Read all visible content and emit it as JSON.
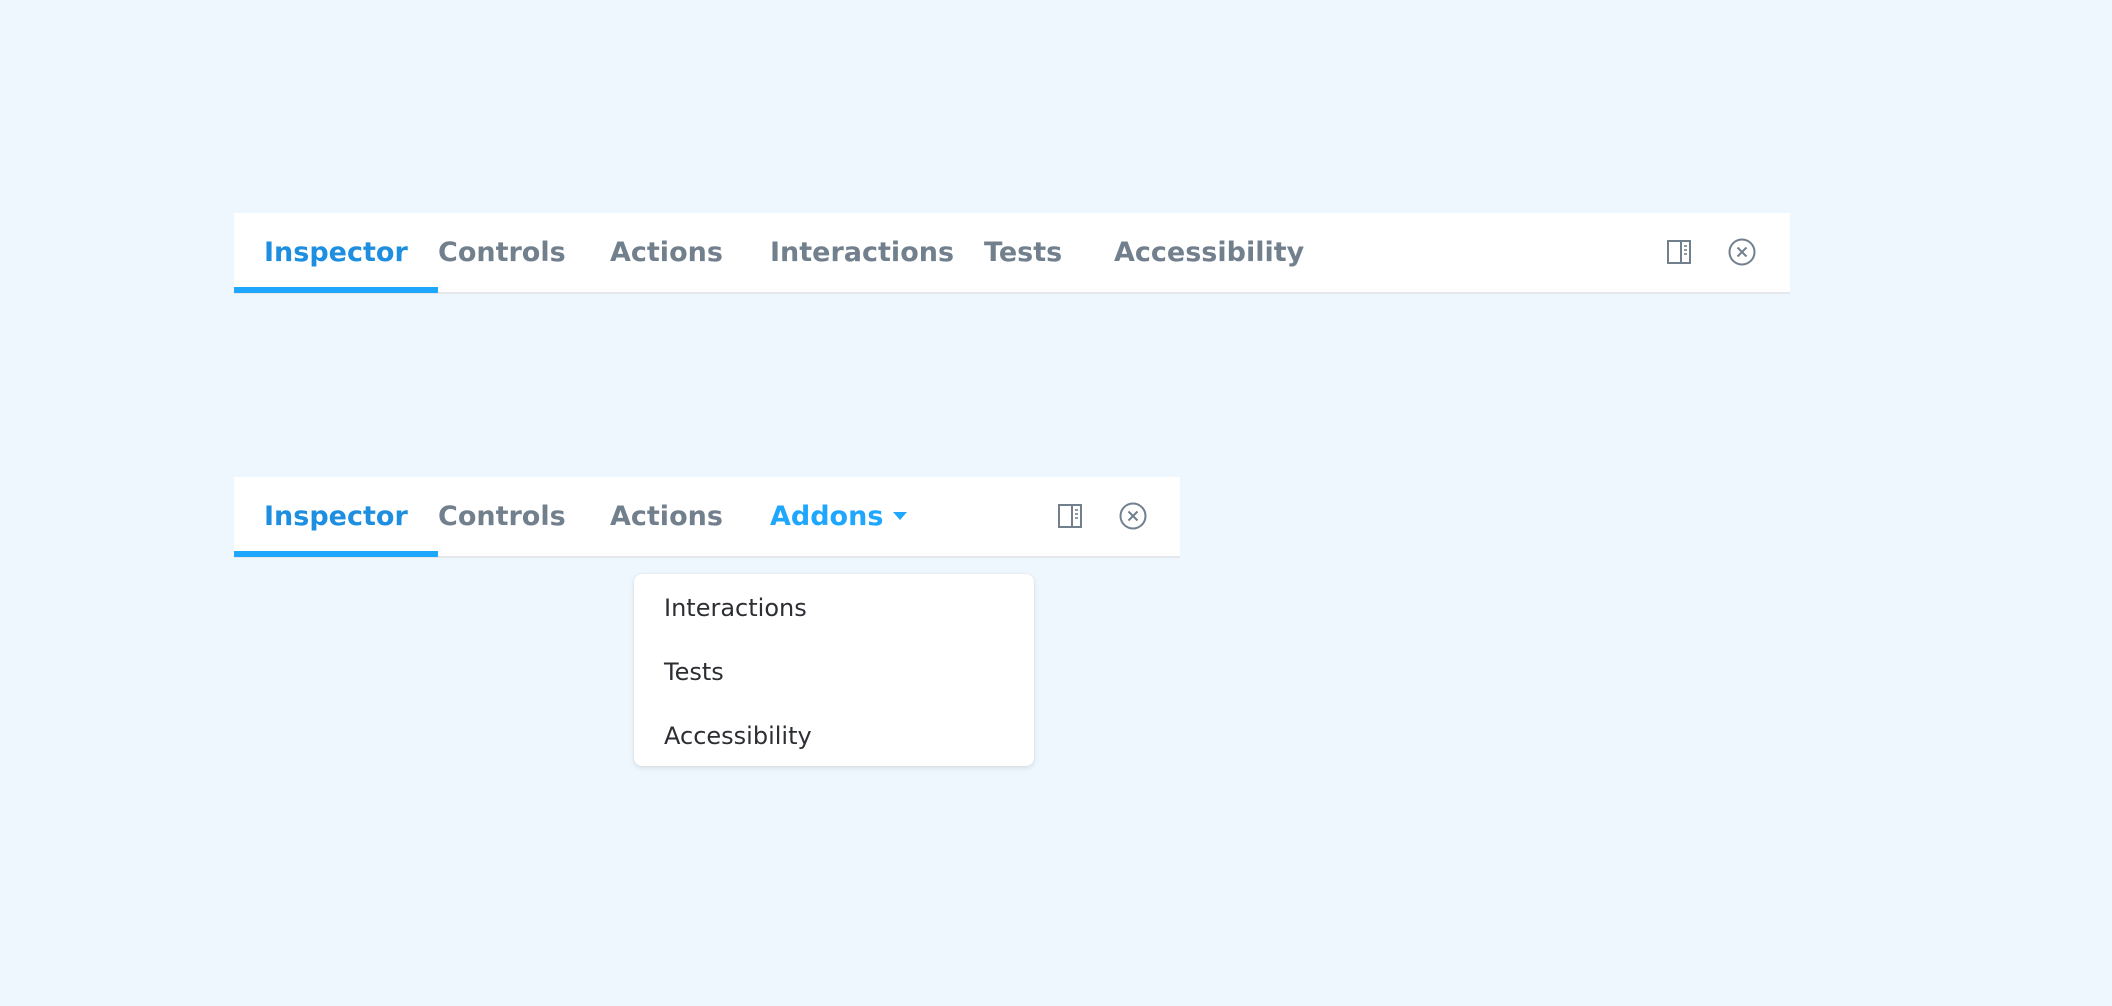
{
  "toolbar_full": {
    "tabs": [
      {
        "label": "Inspector",
        "active": true
      },
      {
        "label": "Controls",
        "active": false
      },
      {
        "label": "Actions",
        "active": false
      },
      {
        "label": "Interactions",
        "active": false
      },
      {
        "label": "Tests",
        "active": false
      },
      {
        "label": "Accessibility",
        "active": false
      }
    ],
    "icons": [
      "panel-toggle-icon",
      "close-circle-icon"
    ]
  },
  "toolbar_compact": {
    "tabs": [
      {
        "label": "Inspector",
        "active": true
      },
      {
        "label": "Controls",
        "active": false
      },
      {
        "label": "Actions",
        "active": false
      }
    ],
    "addons_label": "Addons",
    "icons": [
      "panel-toggle-icon",
      "close-circle-icon"
    ]
  },
  "addons_dropdown": {
    "items": [
      "Interactions",
      "Tests",
      "Accessibility"
    ]
  },
  "colors": {
    "background": "#eff7fe",
    "accent": "#1ea7fd",
    "active_text": "#1e8fe0",
    "inactive_text": "#72808e"
  }
}
